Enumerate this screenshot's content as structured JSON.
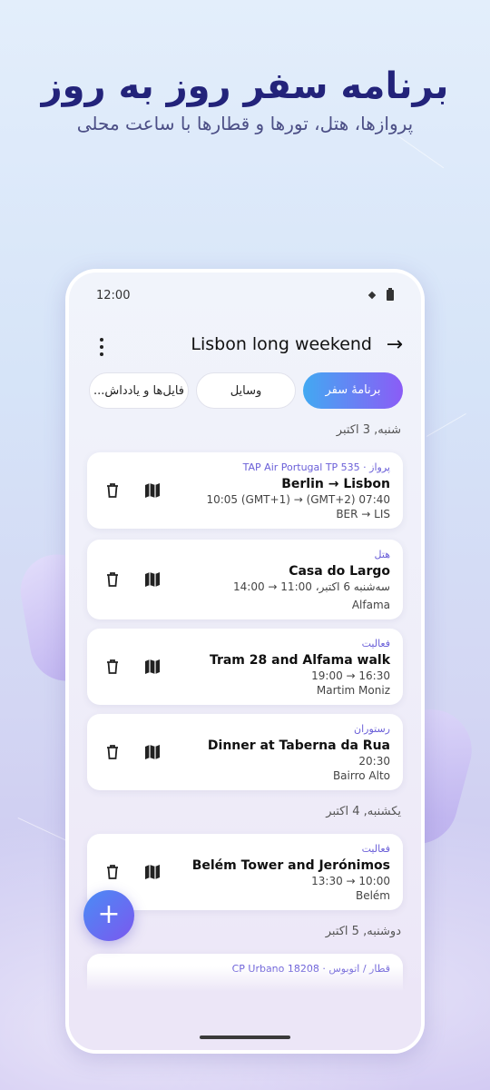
{
  "hero": {
    "title": "برنامه سفر روز به روز",
    "subtitle": "پروازها، هتل، تورها و قطارها با ساعت محلی"
  },
  "status_bar": {
    "time": "12:00",
    "icons": [
      "satellite-icon",
      "battery-icon"
    ]
  },
  "app_bar": {
    "title": "Lisbon long weekend",
    "menu_icon": "more-vert-icon",
    "action_icon": "arrow-right-icon"
  },
  "tabs": [
    {
      "label": "برنامهٔ سفر",
      "active": true
    },
    {
      "label": "وسایل",
      "active": false
    },
    {
      "label": "فایل‌ها و یادداش...",
      "active": false
    }
  ],
  "days": [
    {
      "header": "شنبه, 3 اکتبر",
      "items": [
        {
          "label": "پرواز · TAP Air Portugal TP 535",
          "title": "Berlin → Lisbon",
          "line1": "10:05 (GMT+1) → (GMT+2) 07:40",
          "line2": "BER → LIS"
        },
        {
          "label": "هتل",
          "title": "Casa do Largo",
          "line1": "14:00 → سه‌شنبه 6 اکتبر، 11:00",
          "line2": "Alfama"
        },
        {
          "label": "فعالیت",
          "title": "Tram 28 and Alfama walk",
          "line1": "19:00 → 16:30",
          "line2": "Martim Moniz"
        },
        {
          "label": "رستوران",
          "title": "Dinner at Taberna da Rua",
          "line1": "20:30",
          "line2": "Bairro Alto"
        }
      ]
    },
    {
      "header": "یکشنبه, 4 اکتبر",
      "items": [
        {
          "label": "فعالیت",
          "title": "Belém Tower and Jerónimos",
          "line1": "13:30 → 10:00",
          "line2": "Belém"
        }
      ]
    },
    {
      "header": "دوشنبه, 5 اکتبر",
      "items": [
        {
          "label": "قطار / اتوبوس · CP Urbano 18208",
          "title": "",
          "line1": "",
          "line2": ""
        }
      ]
    }
  ],
  "fab": {
    "label": "+"
  },
  "colors": {
    "accent": "#6a5fd8",
    "tab_gradient_start": "#42a9f2",
    "tab_gradient_end": "#8b5cf6"
  }
}
